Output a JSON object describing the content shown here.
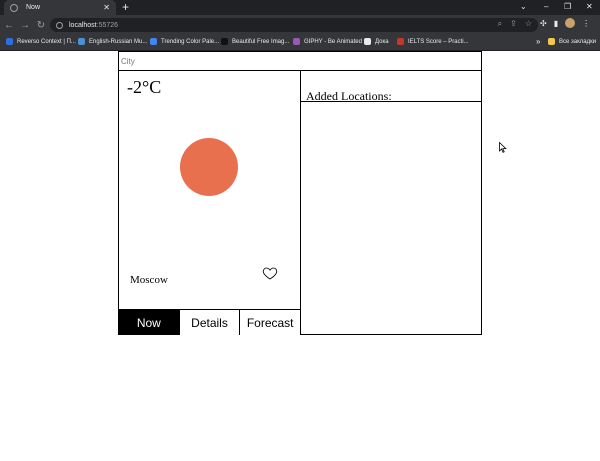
{
  "browser": {
    "tab_title": "Now",
    "tab_close": "✕",
    "new_tab": "+",
    "url_host": "localhost",
    "url_port": ":55726",
    "window_controls": [
      "⌄",
      "–",
      "❐",
      "✕"
    ],
    "bookmarks": [
      {
        "label": "Reverso Context | П...",
        "color": "#2f6fdb"
      },
      {
        "label": "English-Russian Mu...",
        "color": "#4a90d9"
      },
      {
        "label": "Trending Color Pale...",
        "color": "#4285f4"
      },
      {
        "label": "Beautiful Free Imag...",
        "color": "#111111"
      },
      {
        "label": "GIPHY - Be Animated",
        "color": "#9b59b6"
      },
      {
        "label": "Дока",
        "color": "#e8eaed"
      },
      {
        "label": "IELTS Score – Practi...",
        "color": "#c0392b"
      }
    ],
    "bookmarks_more": "»",
    "other_bookmarks": "Все закладки"
  },
  "app": {
    "city_placeholder": "City",
    "temperature": "-2°C",
    "city": "Moscow",
    "sun_color": "#e8704f",
    "favorite_icon": "heart-outline-icon",
    "tabs": [
      {
        "label": "Now",
        "active": true
      },
      {
        "label": "Details",
        "active": false
      },
      {
        "label": "Forecast",
        "active": false
      }
    ],
    "locations_title": "Added Locations:",
    "locations": []
  }
}
